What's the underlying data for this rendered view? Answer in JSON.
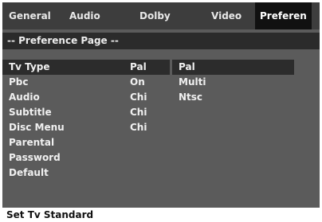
{
  "tabs": [
    {
      "label": "General",
      "active": false
    },
    {
      "label": "Audio",
      "active": false
    },
    {
      "label": "Dolby",
      "active": false
    },
    {
      "label": "Video",
      "active": false
    },
    {
      "label": "Preferen",
      "active": true
    }
  ],
  "page_title": "-- Preference Page --",
  "menu": [
    {
      "label": "Tv Type",
      "value": "Pal",
      "selected": true
    },
    {
      "label": "Pbc",
      "value": "On",
      "selected": false
    },
    {
      "label": "Audio",
      "value": "Chi",
      "selected": false
    },
    {
      "label": "Subtitle",
      "value": "Chi",
      "selected": false
    },
    {
      "label": "Disc Menu",
      "value": "Chi",
      "selected": false
    },
    {
      "label": "Parental",
      "value": "",
      "selected": false
    },
    {
      "label": "Password",
      "value": "",
      "selected": false
    },
    {
      "label": "Default",
      "value": "",
      "selected": false
    }
  ],
  "options": [
    {
      "label": "Pal",
      "selected": true
    },
    {
      "label": "Multi",
      "selected": false
    },
    {
      "label": "Ntsc",
      "selected": false
    }
  ],
  "status_text": "Set Tv Standard",
  "colors": {
    "screen_bg": "#5b5b5b",
    "tabbar_bg": "#3d3d3d",
    "active_tab_bg": "#111111",
    "highlight_bg": "#2c2c2c",
    "text": "#f0f0f0"
  }
}
